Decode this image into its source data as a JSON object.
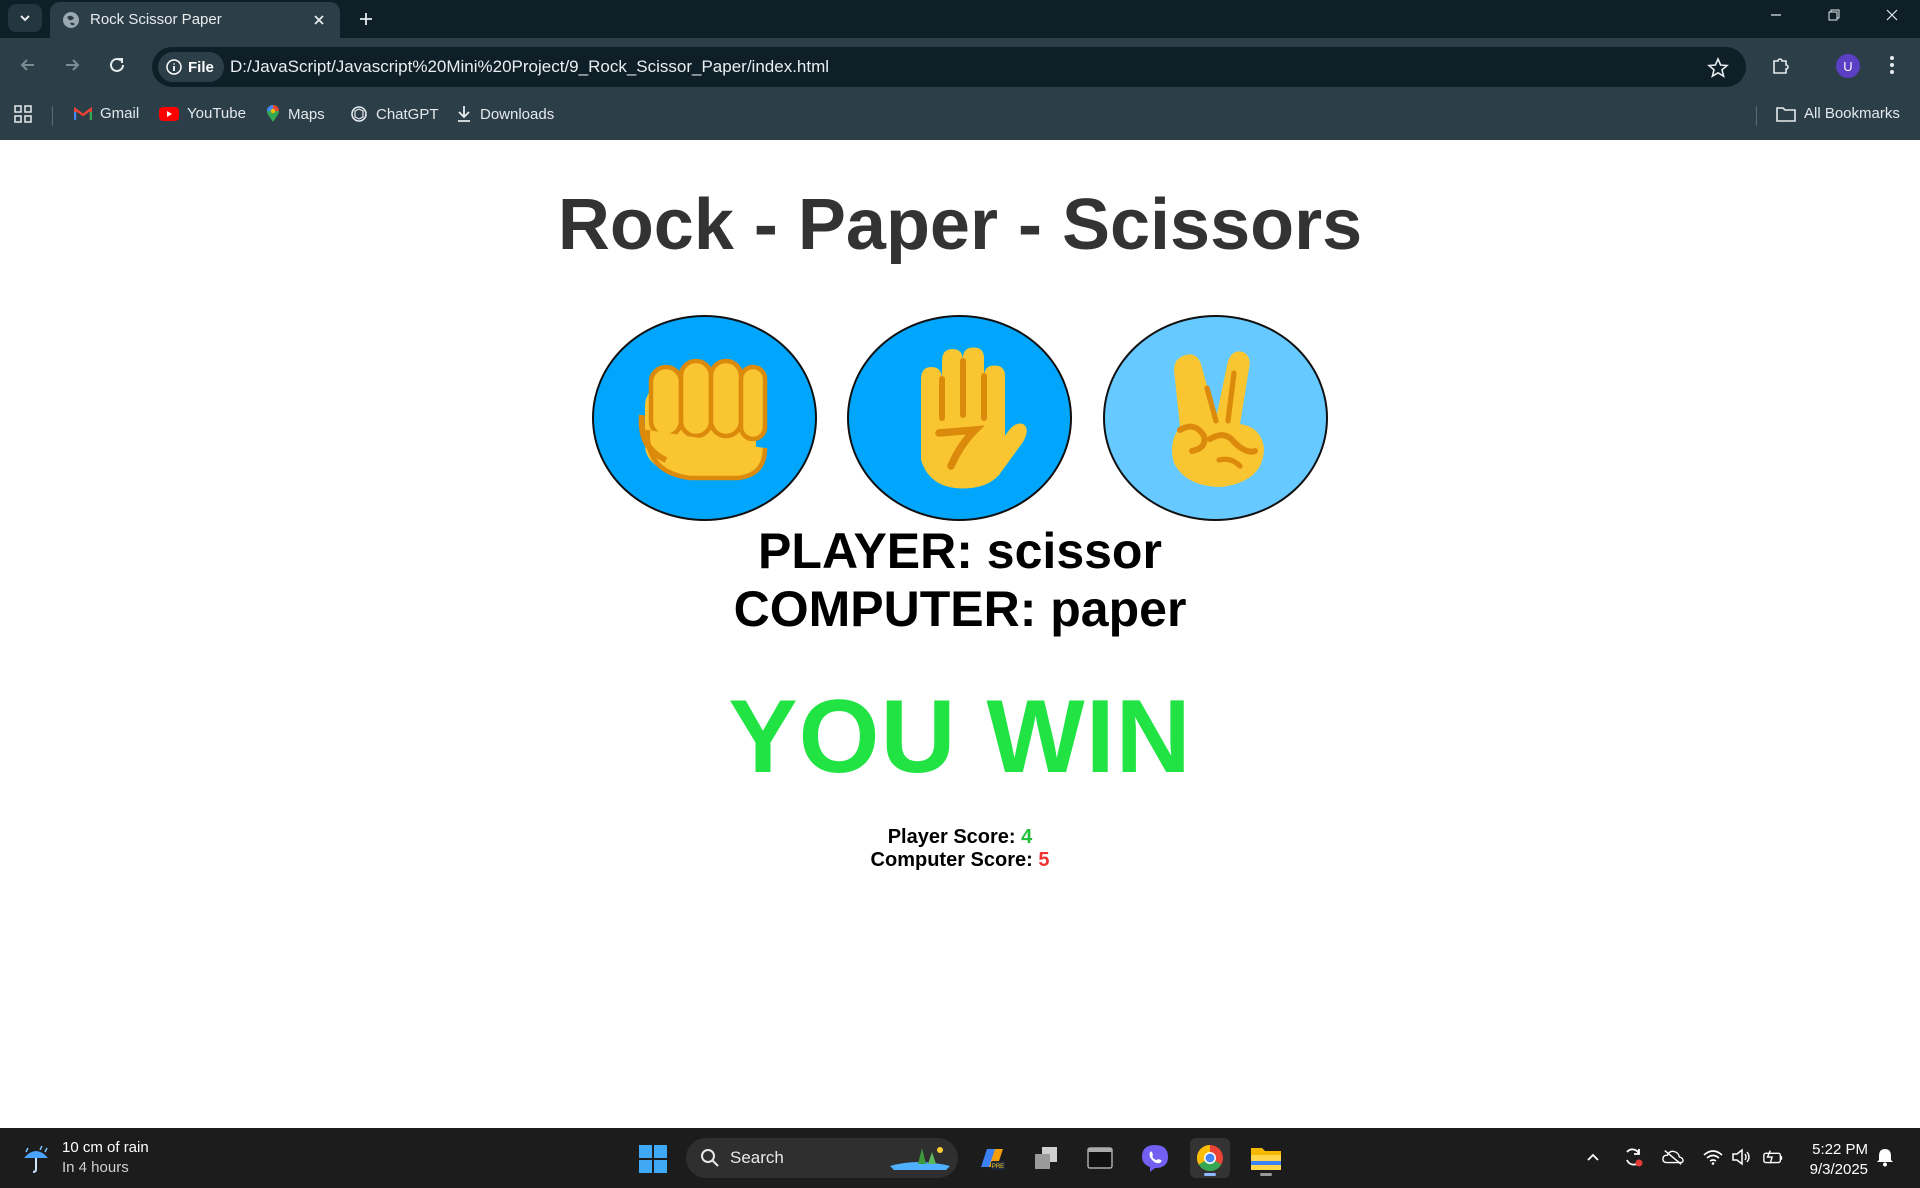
{
  "browser": {
    "tab_title": "Rock Scissor Paper",
    "site_chip_label": "File",
    "url": "D:/JavaScript/Javascript%20Mini%20Project/9_Rock_Scissor_Paper/index.html",
    "avatar_letter": "U",
    "bookmarks": [
      "Gmail",
      "YouTube",
      "Maps",
      "ChatGPT",
      "Downloads"
    ],
    "all_bookmarks_label": "All Bookmarks"
  },
  "game": {
    "title": "Rock - Paper - Scissors",
    "choices": [
      {
        "name": "rock",
        "icon": "fist-icon",
        "bg": "#00a6fb"
      },
      {
        "name": "paper",
        "icon": "raised-hand-icon",
        "bg": "#00a6fb"
      },
      {
        "name": "scissor",
        "icon": "victory-hand-icon",
        "bg": "#66c9ff"
      }
    ],
    "player_line": "PLAYER: scissor",
    "computer_line": "COMPUTER: paper",
    "verdict": "YOU WIN",
    "verdict_color": "#22e344",
    "player_score_label": "Player Score: ",
    "player_score": "4",
    "player_score_color": "#22c03a",
    "computer_score_label": "Computer Score: ",
    "computer_score": "5",
    "computer_score_color": "#ee3333"
  },
  "taskbar": {
    "weather_main": "10 cm of rain",
    "weather_sub": "In 4 hours",
    "search_placeholder": "Search",
    "time": "5:22 PM",
    "date": "9/3/2025"
  }
}
